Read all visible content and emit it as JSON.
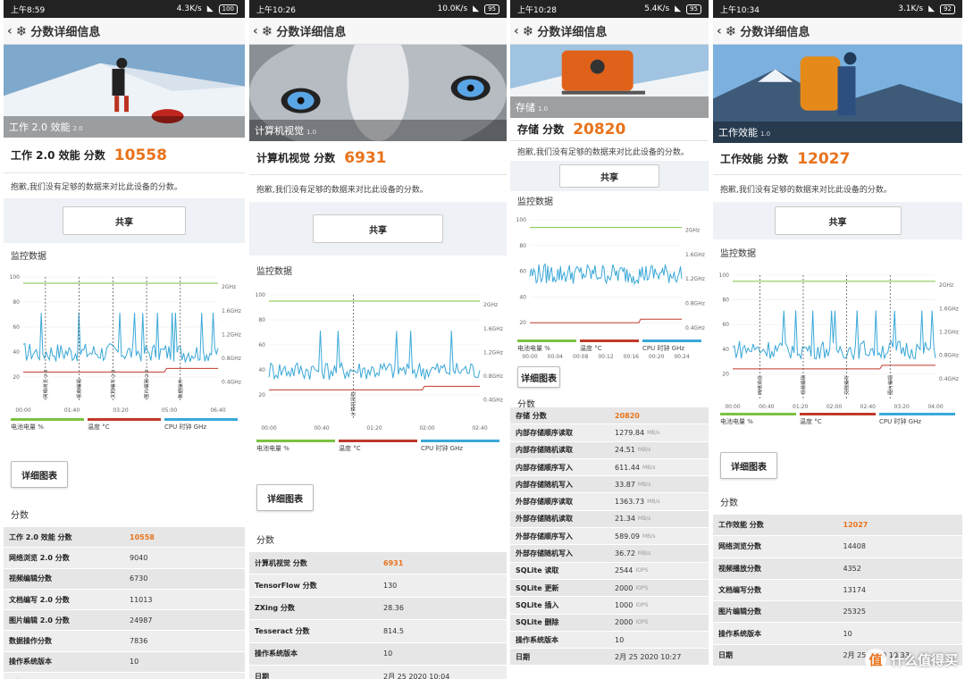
{
  "panels": [
    {
      "status": {
        "time": "上午8:59",
        "net": "4.3K/s",
        "battery": "100"
      },
      "header": {
        "title": "分数详细信息"
      },
      "hero": {
        "caption": "工作 2.0 效能",
        "version": "2.0"
      },
      "score": {
        "label": "工作 2.0 效能 分数",
        "value": "10558"
      },
      "sorry": "抱歉,我们没有足够的数据来对比此设备的分数。",
      "share": "共享",
      "monitor": "监控数据",
      "chart": {
        "yticks": [
          "100",
          "80",
          "60",
          "40",
          "20"
        ],
        "rticks": [
          "2GHz",
          "1.6GHz",
          "1.2GHz",
          "0.8GHz",
          "0.4GHz"
        ],
        "xticks": [
          "00:00",
          "01:40",
          "03:20",
          "05:00",
          "06:40"
        ],
        "markers": [
          "网络浏览 2.0",
          "视频编辑",
          "文档编写 2.0",
          "图片编辑 2.0",
          "数据操作"
        ]
      },
      "legend": [
        "电池电量 %",
        "温度 °C",
        "CPU 时钟 GHz"
      ],
      "detail": "详细图表",
      "fenshu": "分数",
      "rows": [
        {
          "k": "工作 2.0 效能 分数",
          "v": "10558",
          "hl": true
        },
        {
          "k": "网络浏览 2.0 分数",
          "v": "9040"
        },
        {
          "k": "视频编辑分数",
          "v": "6730"
        },
        {
          "k": "文档编写 2.0 分数",
          "v": "11013"
        },
        {
          "k": "图片编辑 2.0 分数",
          "v": "24987"
        },
        {
          "k": "数据操作分数",
          "v": "7836"
        },
        {
          "k": "操作系统版本",
          "v": "10"
        },
        {
          "k": "日期",
          "v": "2月 25 2020 08:44"
        }
      ]
    },
    {
      "status": {
        "time": "上午10:26",
        "net": "10.0K/s",
        "battery": "95"
      },
      "header": {
        "title": "分数详细信息"
      },
      "hero": {
        "caption": "计算机视觉",
        "version": "1.0"
      },
      "score": {
        "label": "计算机视觉 分数",
        "value": "6931"
      },
      "sorry": "抱歉,我们没有足够的数据来对比此设备的分数。",
      "share": "共享",
      "monitor": "监控数据",
      "chart": {
        "yticks": [
          "100",
          "80",
          "60",
          "40",
          "20"
        ],
        "rticks": [
          "2GHz",
          "1.6GHz",
          "1.2GHz",
          "0.8GHz",
          "0.4GHz"
        ],
        "xticks": [
          "00:00",
          "00:40",
          "01:20",
          "02:00",
          "02:40"
        ],
        "markers": [
          "计算机视觉"
        ]
      },
      "legend": [
        "电池电量 %",
        "温度 °C",
        "CPU 时钟 GHz"
      ],
      "detail": "详细图表",
      "fenshu": "分数",
      "rows": [
        {
          "k": "计算机视觉 分数",
          "v": "6931",
          "hl": true
        },
        {
          "k": "TensorFlow 分数",
          "v": "130"
        },
        {
          "k": "ZXing 分数",
          "v": "28.36"
        },
        {
          "k": "Tesseract 分数",
          "v": "814.5"
        },
        {
          "k": "操作系统版本",
          "v": "10"
        },
        {
          "k": "日期",
          "v": "2月 25 2020 10:04"
        }
      ]
    },
    {
      "status": {
        "time": "上午10:28",
        "net": "5.4K/s",
        "battery": "95"
      },
      "header": {
        "title": "分数详细信息"
      },
      "hero": {
        "caption": "存储",
        "version": "1.0"
      },
      "score": {
        "label": "存储 分数",
        "value": "20820"
      },
      "sorry": "抱歉,我们没有足够的数据来对比此设备的分数。",
      "share": "共享",
      "monitor": "监控数据",
      "chart": {
        "yticks": [
          "100",
          "80",
          "60",
          "40",
          "20"
        ],
        "rticks": [
          "2GHz",
          "1.6GHz",
          "1.2GHz",
          "0.8GHz",
          "0.4GHz"
        ],
        "xticks": [
          "00:00",
          "00:04",
          "00:08",
          "00:12",
          "00:16",
          "00:20",
          "00:24"
        ],
        "markers": []
      },
      "legend": [
        "电池电量 %",
        "温度 °C",
        "CPU 时钟 GHz"
      ],
      "detail": "详细图表",
      "fenshu": "分数",
      "rows": [
        {
          "k": "存储 分数",
          "v": "20820",
          "hl": true
        },
        {
          "k": "内部存储顺序读取",
          "v": "1279.84",
          "u": "MB/s"
        },
        {
          "k": "内部存储随机读取",
          "v": "24.51",
          "u": "MB/s"
        },
        {
          "k": "内部存储顺序写入",
          "v": "611.44",
          "u": "MB/s"
        },
        {
          "k": "内部存储随机写入",
          "v": "33.87",
          "u": "MB/s"
        },
        {
          "k": "外部存储顺序读取",
          "v": "1363.73",
          "u": "MB/s"
        },
        {
          "k": "外部存储随机读取",
          "v": "21.34",
          "u": "MB/s"
        },
        {
          "k": "外部存储顺序写入",
          "v": "589.09",
          "u": "MB/s"
        },
        {
          "k": "外部存储随机写入",
          "v": "36.72",
          "u": "MB/s"
        },
        {
          "k": "SQLite 读取",
          "v": "2544",
          "u": "IOPS"
        },
        {
          "k": "SQLite 更新",
          "v": "2000",
          "u": "IOPS"
        },
        {
          "k": "SQLite 插入",
          "v": "1000",
          "u": "IOPS"
        },
        {
          "k": "SQLite 删除",
          "v": "2000",
          "u": "IOPS"
        },
        {
          "k": "操作系统版本",
          "v": "10"
        },
        {
          "k": "日期",
          "v": "2月 25 2020 10:27"
        }
      ]
    },
    {
      "status": {
        "time": "上午10:34",
        "net": "3.1K/s",
        "battery": "92"
      },
      "header": {
        "title": "分数详细信息"
      },
      "hero": {
        "caption": "工作效能",
        "version": "1.0"
      },
      "score": {
        "label": "工作效能 分数",
        "value": "12027"
      },
      "sorry": "抱歉,我们没有足够的数据来对比此设备的分数。",
      "share": "共享",
      "monitor": "监控数据",
      "chart": {
        "yticks": [
          "100",
          "80",
          "60",
          "40",
          "20"
        ],
        "rticks": [
          "2GHz",
          "1.6GHz",
          "1.2GHz",
          "0.8GHz",
          "0.4GHz"
        ],
        "xticks": [
          "00:00",
          "00:40",
          "01:20",
          "02:00",
          "02:40",
          "03:20",
          "04:00"
        ],
        "markers": [
          "网络浏览",
          "视频编辑",
          "文档编写",
          "图片编辑"
        ]
      },
      "legend": [
        "电池电量 %",
        "温度 °C",
        "CPU 时钟 GHz"
      ],
      "detail": "详细图表",
      "fenshu": "分数",
      "rows": [
        {
          "k": "工作效能 分数",
          "v": "12027",
          "hl": true
        },
        {
          "k": "网络浏览分数",
          "v": "14408"
        },
        {
          "k": "视频播放分数",
          "v": "4352"
        },
        {
          "k": "文档编写分数",
          "v": "13174"
        },
        {
          "k": "图片编辑分数",
          "v": "25325"
        },
        {
          "k": "操作系统版本",
          "v": "10"
        },
        {
          "k": "日期",
          "v": "2月 25 2020 10:33"
        }
      ]
    }
  ],
  "watermark": {
    "icon": "值",
    "text": "什么值得买"
  },
  "colors": {
    "battery": "#7cc242",
    "temp": "#c0392b",
    "cpu": "#3aa8d8",
    "score": "#e8731c"
  }
}
